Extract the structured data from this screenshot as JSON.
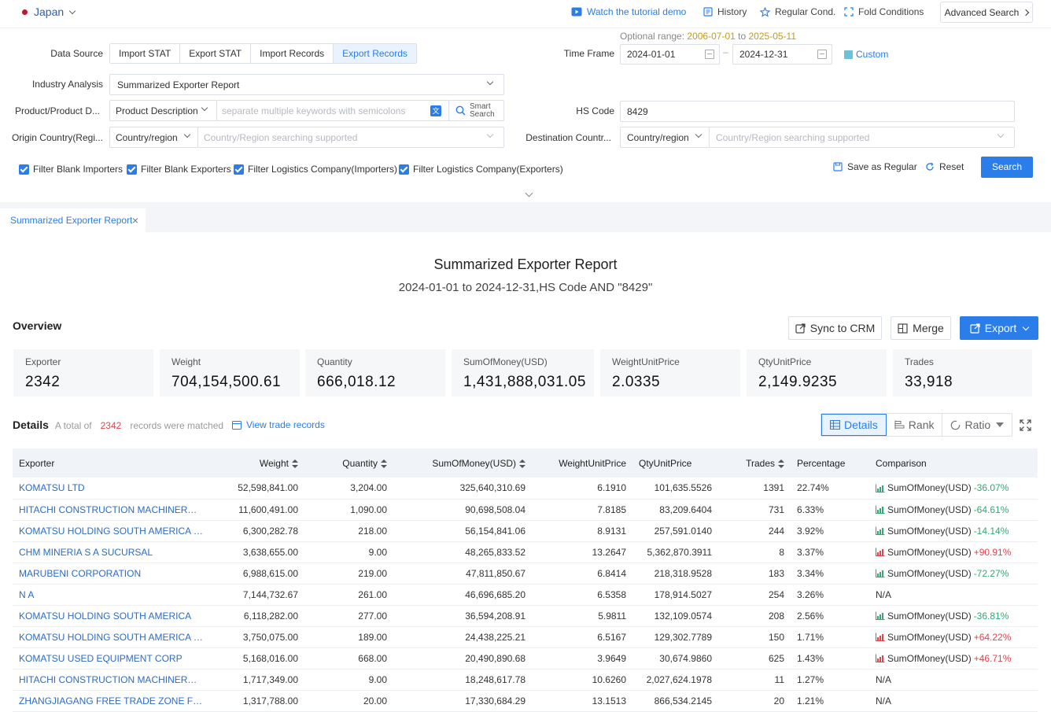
{
  "topbar": {
    "country": "Japan",
    "tutorial": "Watch the tutorial demo",
    "history": "History",
    "regular_cond": "Regular Cond.",
    "fold": "Fold Conditions",
    "advanced": "Advanced Search"
  },
  "filters": {
    "optional_range_label": "Optional range:",
    "optional_from": "2006-07-01",
    "optional_to_word": "to",
    "optional_to": "2025-05-11",
    "data_source_label": "Data Source",
    "data_source_options": [
      "Import STAT",
      "Export STAT",
      "Import Records",
      "Export Records"
    ],
    "data_source_selected": "Export Records",
    "time_frame_label": "Time Frame",
    "date_from": "2024-01-01",
    "date_to": "2024-12-31",
    "date_sep": "–",
    "custom": "Custom",
    "industry_label": "Industry Analysis",
    "industry_value": "Summarized Exporter Report",
    "product_label": "Product/Product D...",
    "product_type": "Product Description",
    "keywords_placeholder": "separate multiple keywords with semicolons",
    "smart_search_1": "Smart",
    "smart_search_2": "Search",
    "hs_label": "HS Code",
    "hs_value": "8429",
    "origin_label": "Origin Country(Regi...",
    "origin_type": "Country/region",
    "origin_placeholder": "Country/Region searching supported",
    "dest_label": "Destination Countr...",
    "dest_type": "Country/region",
    "dest_placeholder": "Country/Region searching supported",
    "checks": [
      "Filter Blank Importers",
      "Filter Blank Exporters",
      "Filter Logistics Company(Importers)",
      "Filter Logistics Company(Exporters)"
    ],
    "save_regular": "Save as Regular",
    "reset": "Reset",
    "search": "Search"
  },
  "tab": {
    "label": "Summarized Exporter Report",
    "close": "×"
  },
  "report": {
    "title": "Summarized Exporter Report",
    "subtitle": "2024-01-01 to 2024-12-31,HS Code AND \"8429\""
  },
  "overview": {
    "label": "Overview",
    "sync": "Sync to CRM",
    "merge": "Merge",
    "export": "Export",
    "cards": [
      {
        "title": "Exporter",
        "value": "2342"
      },
      {
        "title": "Weight",
        "value": "704,154,500.61"
      },
      {
        "title": "Quantity",
        "value": "666,018.12"
      },
      {
        "title": "SumOfMoney(USD)",
        "value": "1,431,888,031.05"
      },
      {
        "title": "WeightUnitPrice",
        "value": "2.0335"
      },
      {
        "title": "QtyUnitPrice",
        "value": "2,149.9235"
      },
      {
        "title": "Trades",
        "value": "33,918"
      }
    ]
  },
  "details": {
    "label": "Details",
    "total_pre": "A total of",
    "total": "2342",
    "total_post": "records were matched",
    "view_trade": "View trade records",
    "views": [
      "Details",
      "Rank",
      "Ratio"
    ]
  },
  "table": {
    "headers": [
      "Exporter",
      "Weight",
      "Quantity",
      "SumOfMoney(USD)",
      "WeightUnitPrice",
      "QtyUnitPrice",
      "Trades",
      "Percentage",
      "Comparison"
    ],
    "rows": [
      {
        "exporter": "KOMATSU LTD",
        "weight": "52,598,841.00",
        "quantity": "3,204.00",
        "money": "325,640,310.69",
        "wup": "6.1910",
        "qup": "101,635.5526",
        "trades": "1391",
        "pct": "22.74%",
        "cmp_label": "SumOfMoney(USD)",
        "cmp_val": "-36.07%",
        "dir": "down"
      },
      {
        "exporter": "HITACHI CONSTRUCTION MACHINERY CO LTD",
        "weight": "11,600,491.00",
        "quantity": "1,090.00",
        "money": "90,698,508.04",
        "wup": "7.8185",
        "qup": "83,209.6404",
        "trades": "731",
        "pct": "6.33%",
        "cmp_label": "SumOfMoney(USD)",
        "cmp_val": "-64.61%",
        "dir": "down"
      },
      {
        "exporter": "KOMATSU HOLDING SOUTH AMERICA LIMIT...",
        "weight": "6,300,282.78",
        "quantity": "218.00",
        "money": "56,154,841.06",
        "wup": "8.9131",
        "qup": "257,591.0140",
        "trades": "244",
        "pct": "3.92%",
        "cmp_label": "SumOfMoney(USD)",
        "cmp_val": "-14.14%",
        "dir": "down"
      },
      {
        "exporter": "CHM MINERIA S A SUCURSAL",
        "weight": "3,638,655.00",
        "quantity": "9.00",
        "money": "48,265,833.52",
        "wup": "13.2647",
        "qup": "5,362,870.3911",
        "trades": "8",
        "pct": "3.37%",
        "cmp_label": "SumOfMoney(USD)",
        "cmp_val": "+90.91%",
        "dir": "up"
      },
      {
        "exporter": "MARUBENI CORPORATION",
        "weight": "6,988,615.00",
        "quantity": "219.00",
        "money": "47,811,850.67",
        "wup": "6.8414",
        "qup": "218,318.9528",
        "trades": "183",
        "pct": "3.34%",
        "cmp_label": "SumOfMoney(USD)",
        "cmp_val": "-72.27%",
        "dir": "down"
      },
      {
        "exporter": "N A",
        "weight": "7,144,732.67",
        "quantity": "261.00",
        "money": "46,696,685.20",
        "wup": "6.5358",
        "qup": "178,914.5027",
        "trades": "254",
        "pct": "3.26%",
        "cmp_label": "N/A",
        "cmp_val": "",
        "dir": "none"
      },
      {
        "exporter": "KOMATSU HOLDING SOUTH AMERICA",
        "weight": "6,118,282.00",
        "quantity": "277.00",
        "money": "36,594,208.91",
        "wup": "5.9811",
        "qup": "132,109.0574",
        "trades": "208",
        "pct": "2.56%",
        "cmp_label": "SumOfMoney(USD)",
        "cmp_val": "-36.81%",
        "dir": "down"
      },
      {
        "exporter": "KOMATSU HOLDING SOUTH AMERICA LTDA",
        "weight": "3,750,075.00",
        "quantity": "189.00",
        "money": "24,438,225.21",
        "wup": "6.5167",
        "qup": "129,302.7789",
        "trades": "150",
        "pct": "1.71%",
        "cmp_label": "SumOfMoney(USD)",
        "cmp_val": "+64.22%",
        "dir": "up"
      },
      {
        "exporter": "KOMATSU USED EQUIPMENT CORP",
        "weight": "5,168,016.00",
        "quantity": "668.00",
        "money": "20,490,890.68",
        "wup": "3.9649",
        "qup": "30,674.9860",
        "trades": "625",
        "pct": "1.43%",
        "cmp_label": "SumOfMoney(USD)",
        "cmp_val": "+46.71%",
        "dir": "up"
      },
      {
        "exporter": "HITACHI CONSTRUCTION MACHINERY CO LT...",
        "weight": "1,717,349.00",
        "quantity": "9.00",
        "money": "18,248,617.78",
        "wup": "10.6260",
        "qup": "2,027,624.1978",
        "trades": "11",
        "pct": "1.27%",
        "cmp_label": "N/A",
        "cmp_val": "",
        "dir": "none"
      },
      {
        "exporter": "ZHANGJIAGANG FREE TRADE ZONE FRIEND ...",
        "weight": "1,317,788.00",
        "quantity": "20.00",
        "money": "17,330,684.29",
        "wup": "13.1513",
        "qup": "866,534.2145",
        "trades": "20",
        "pct": "1.21%",
        "cmp_label": "N/A",
        "cmp_val": "",
        "dir": "none"
      }
    ]
  },
  "colors": {
    "accent": "#2b7de9",
    "up": "#e0454b",
    "down": "#2faa73",
    "flag": "#c3162f"
  }
}
